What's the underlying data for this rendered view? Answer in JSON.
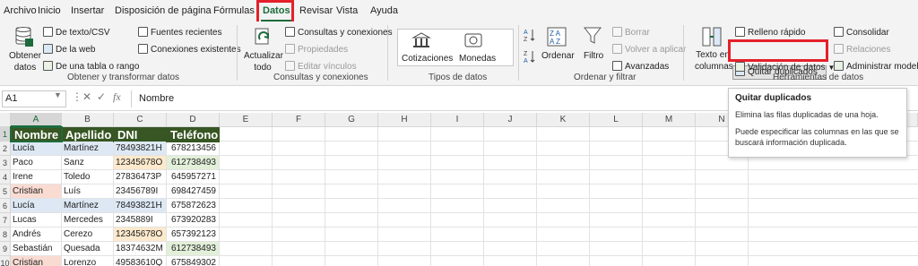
{
  "menu": {
    "tabs": [
      "Archivo",
      "Inicio",
      "Insertar",
      "Disposición de página",
      "Fórmulas",
      "Datos",
      "Revisar",
      "Vista",
      "Ayuda"
    ],
    "active": "Datos"
  },
  "ribbon": {
    "groups": {
      "obtener": {
        "label": "Obtener y transformar datos",
        "obtener_datos": "Obtener datos",
        "obtener_datos_l1": "Obtener",
        "obtener_datos_l2": "datos",
        "de_texto": "De texto/CSV",
        "de_web": "De la web",
        "de_tabla": "De una tabla o rango",
        "fuentes_recientes": "Fuentes recientes",
        "conexiones_existentes": "Conexiones existentes"
      },
      "consultas": {
        "label": "Consultas y conexiones",
        "actualizar_l1": "Actualizar",
        "actualizar_l2": "todo",
        "consultas_conexiones": "Consultas y conexiones",
        "propiedades": "Propiedades",
        "editar_vinculos": "Editar vínculos"
      },
      "tipos": {
        "label": "Tipos de datos",
        "cotizaciones": "Cotizaciones",
        "monedas": "Monedas"
      },
      "ordenar": {
        "label": "Ordenar y filtrar",
        "ordenar": "Ordenar",
        "filtro": "Filtro",
        "borrar": "Borrar",
        "volver_aplicar": "Volver a aplicar",
        "avanzadas": "Avanzadas"
      },
      "herramientas": {
        "label": "Herramientas de datos",
        "texto_columnas_l1": "Texto en",
        "texto_columnas_l2": "columnas",
        "relleno_rapido": "Relleno rápido",
        "quitar_duplicados": "Quitar duplicados",
        "validacion": "Validación de datos",
        "consolidar": "Consolidar",
        "relaciones": "Relaciones",
        "administrar_modelo": "Administrar modelo"
      }
    }
  },
  "formula_bar": {
    "name_box": "A1",
    "fx": "fx",
    "content": "Nombre"
  },
  "grid": {
    "columns": [
      "A",
      "B",
      "C",
      "D",
      "E",
      "F",
      "G",
      "H",
      "I",
      "J",
      "K",
      "L",
      "M",
      "N"
    ],
    "rows": [
      "1",
      "2",
      "3",
      "4",
      "5",
      "6",
      "7",
      "8",
      "9",
      "10"
    ],
    "header_row": [
      "Nombre",
      "Apellido",
      "DNI",
      "Teléfono"
    ],
    "data": [
      [
        "Lucía",
        "Martínez",
        "78493821H",
        "678213456"
      ],
      [
        "Paco",
        "Sanz",
        "12345678O",
        "612738493"
      ],
      [
        "Irene",
        "Toledo",
        "27836473P",
        "645957271"
      ],
      [
        "Cristian",
        "Luís",
        "23456789I",
        "698427459"
      ],
      [
        "Lucía",
        "Martínez",
        "78493821H",
        "675872623"
      ],
      [
        "Lucas",
        "Mercedes",
        "2345889I",
        "673920283"
      ],
      [
        "Andrés",
        "Cerezo",
        "12345678O",
        "657392123"
      ],
      [
        "Sebastián",
        "Quesada",
        "18374632M",
        "612738493"
      ],
      [
        "Cristian",
        "Lorenzo",
        "49583610Q",
        "675849302"
      ]
    ],
    "colors": {
      "header_bg": "#375623",
      "blue_fill": "#dde8f4",
      "orange_fill": "#fde9cc",
      "red_fill": "#fadbd2",
      "green_fill": "#e2efd9"
    }
  },
  "tooltip": {
    "title": "Quitar duplicados",
    "line1": "Elimina las filas duplicadas de una hoja.",
    "line2": "Puede especificar las columnas en las que se buscará información duplicada."
  },
  "accent": "#1d6b3c",
  "highlight_color": "#e4202a"
}
